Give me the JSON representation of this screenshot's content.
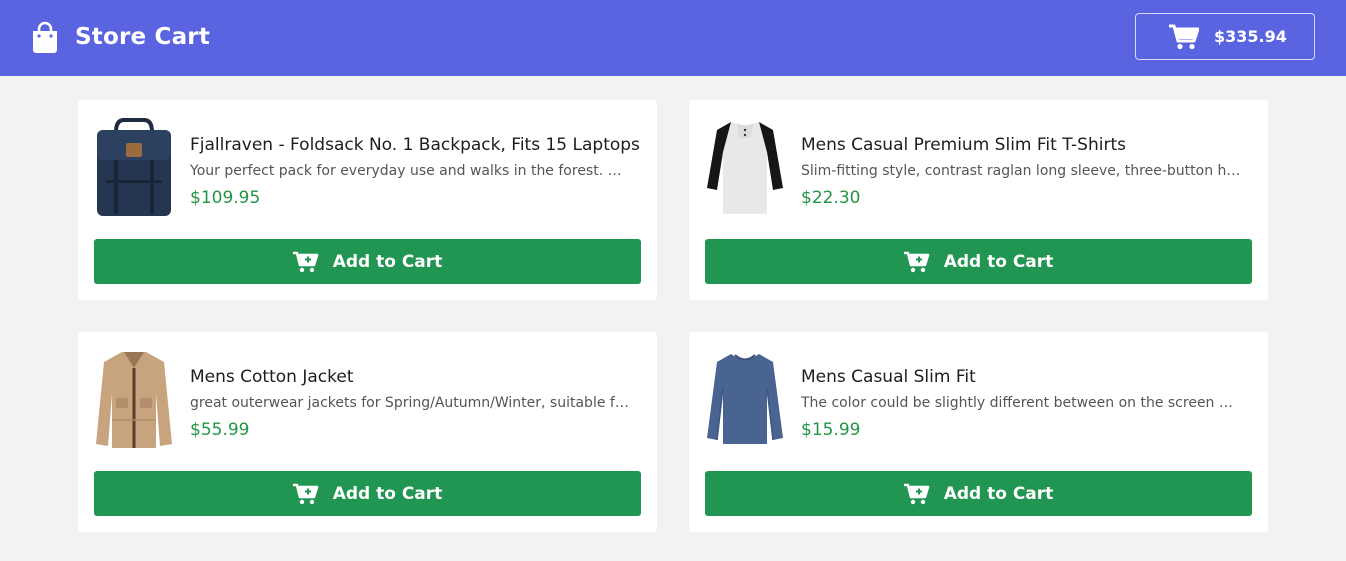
{
  "header": {
    "title": "Store Cart",
    "cart_total": "$335.94",
    "brand_icon": "shopping-bag-icon",
    "cart_icon": "shopping-cart-icon"
  },
  "products": [
    {
      "title": "Fjallraven - Foldsack No. 1 Backpack, Fits 15 Laptops",
      "description": "Your perfect pack for everyday use and walks in the forest. Stash your laptop (up to 15 inches) in the padded sleeve, your everyday",
      "price": "$109.95",
      "button_label": "Add to Cart"
    },
    {
      "title": "Mens Casual Premium Slim Fit T-Shirts",
      "description": "Slim-fitting style, contrast raglan long sleeve, three-button henley placket, light weight & soft fabric for breathable and comfortable wearing.",
      "price": "$22.30",
      "button_label": "Add to Cart"
    },
    {
      "title": "Mens Cotton Jacket",
      "description": "great outerwear jackets for Spring/Autumn/Winter, suitable for many occasions, such as working, hiking, camping, mountain/rock climbing",
      "price": "$55.99",
      "button_label": "Add to Cart"
    },
    {
      "title": "Mens Casual Slim Fit",
      "description": "The color could be slightly different between on the screen and in practice.",
      "price": "$15.99",
      "button_label": "Add to Cart"
    }
  ],
  "colors": {
    "header": "#5a63e0",
    "button": "#219552",
    "price": "#239644",
    "background": "#f1f2f4"
  }
}
